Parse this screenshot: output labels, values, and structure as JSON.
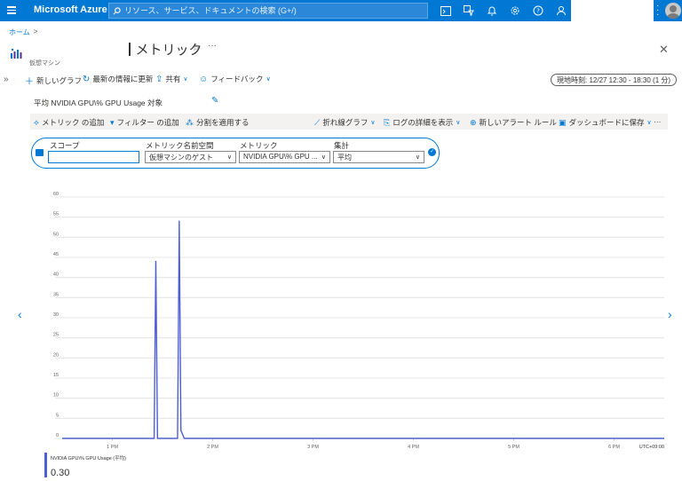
{
  "topbar": {
    "brand": "Microsoft Azure",
    "search_placeholder": "リソース、サービス、ドキュメントの検索 (G+/)",
    "accent": "#0078d4"
  },
  "breadcrumb": {
    "home": "ホーム",
    "sep": ">"
  },
  "header": {
    "title": "メトリック",
    "subtitle": "仮想マシン",
    "star": "☆",
    "more": "···",
    "close": "✕"
  },
  "commands": {
    "new_chart": "新しいグラフ",
    "refresh": "最新の情報に更新",
    "share": "共有",
    "feedback": "フィードバック",
    "time_range": "現地時刻: 12/27 12:30 - 18:30 (1 分)"
  },
  "chart_title": "平均 NVIDIA GPU\\% GPU Usage 対象",
  "chart_toolbar": {
    "add_metric": "メトリック の追加",
    "add_filter": "フィルター の追加",
    "apply_split": "分割を適用する",
    "line_chart": "折れ線グラフ",
    "drill_logs": "ログの詳細を表示",
    "new_alert": "新しいアラート ルール",
    "save_dashboard": "ダッシュボードに保存",
    "more": "···"
  },
  "selector": {
    "scope_label": "スコープ",
    "scope_value": "",
    "namespace_label": "メトリック名前空間",
    "namespace_value": "仮想マシンのゲスト",
    "metric_label": "メトリック",
    "metric_value": "NVIDIA GPU\\% GPU ...",
    "aggregation_label": "集計",
    "aggregation_value": "平均"
  },
  "chart_data": {
    "type": "line",
    "y_ticks": [
      "60",
      "55",
      "50",
      "45",
      "40",
      "35",
      "30",
      "25",
      "20",
      "15",
      "10",
      "5",
      "0"
    ],
    "ylim": [
      0,
      60
    ],
    "x_ticks": [
      "1 PM",
      "2 PM",
      "3 PM",
      "4 PM",
      "5 PM",
      "6 PM"
    ],
    "timezone": "UTC+09:00",
    "series": [
      {
        "name": "NVIDIA GPU\\% GPU Usage (平均)",
        "color": "#4e5fd6",
        "x_minutes": [
          0,
          30,
          55,
          56,
          57,
          58,
          69,
          70,
          71,
          72,
          73,
          74,
          360
        ],
        "y": [
          0,
          0,
          0,
          44,
          0,
          0,
          0,
          54,
          2,
          1,
          0,
          0,
          0
        ]
      }
    ],
    "x_start": "12:30",
    "x_end": "18:30",
    "grid": true
  },
  "legend": {
    "name": "NVIDIA GPU\\% GPU Usage (平均)",
    "value": "0.30"
  }
}
